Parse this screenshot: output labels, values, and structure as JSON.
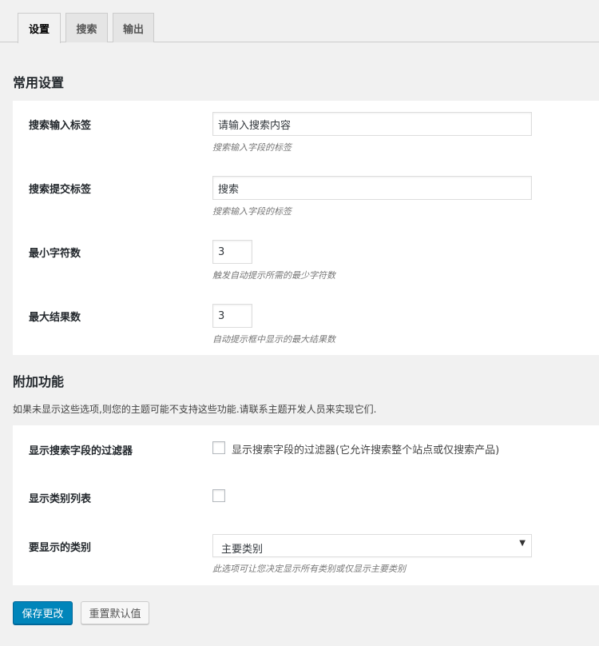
{
  "tabs": [
    {
      "label": "设置",
      "active": true
    },
    {
      "label": "搜索",
      "active": false
    },
    {
      "label": "输出",
      "active": false
    }
  ],
  "general": {
    "title": "常用设置",
    "fields": [
      {
        "label": "搜索输入标签",
        "value": "请输入搜索内容",
        "description": "搜索输入字段的标签"
      },
      {
        "label": "搜索提交标签",
        "value": "搜索",
        "description": "搜索输入字段的标签"
      },
      {
        "label": "最小字符数",
        "value": "3",
        "description": "触发自动提示所需的最少字符数"
      },
      {
        "label": "最大结果数",
        "value": "3",
        "description": "自动提示框中显示的最大结果数"
      }
    ]
  },
  "extras": {
    "title": "附加功能",
    "note": "如果未显示这些选项,则您的主题可能不支持这些功能.请联系主题开发人员来实现它们.",
    "filter": {
      "label": "显示搜索字段的过滤器",
      "checkbox_label": "显示搜索字段的过滤器(它允许搜索整个站点或仅搜索产品)",
      "checked": false
    },
    "category_list": {
      "label": "显示类别列表",
      "checked": false
    },
    "category_select": {
      "label": "要显示的类别",
      "selected": "主要类别",
      "description": "此选项可让您决定显示所有类别或仅显示主要类别"
    }
  },
  "buttons": {
    "save": "保存更改",
    "reset": "重置默认值"
  },
  "colors": {
    "primary": "#0085ba",
    "background": "#f1f1f1",
    "panel": "#ffffff"
  }
}
